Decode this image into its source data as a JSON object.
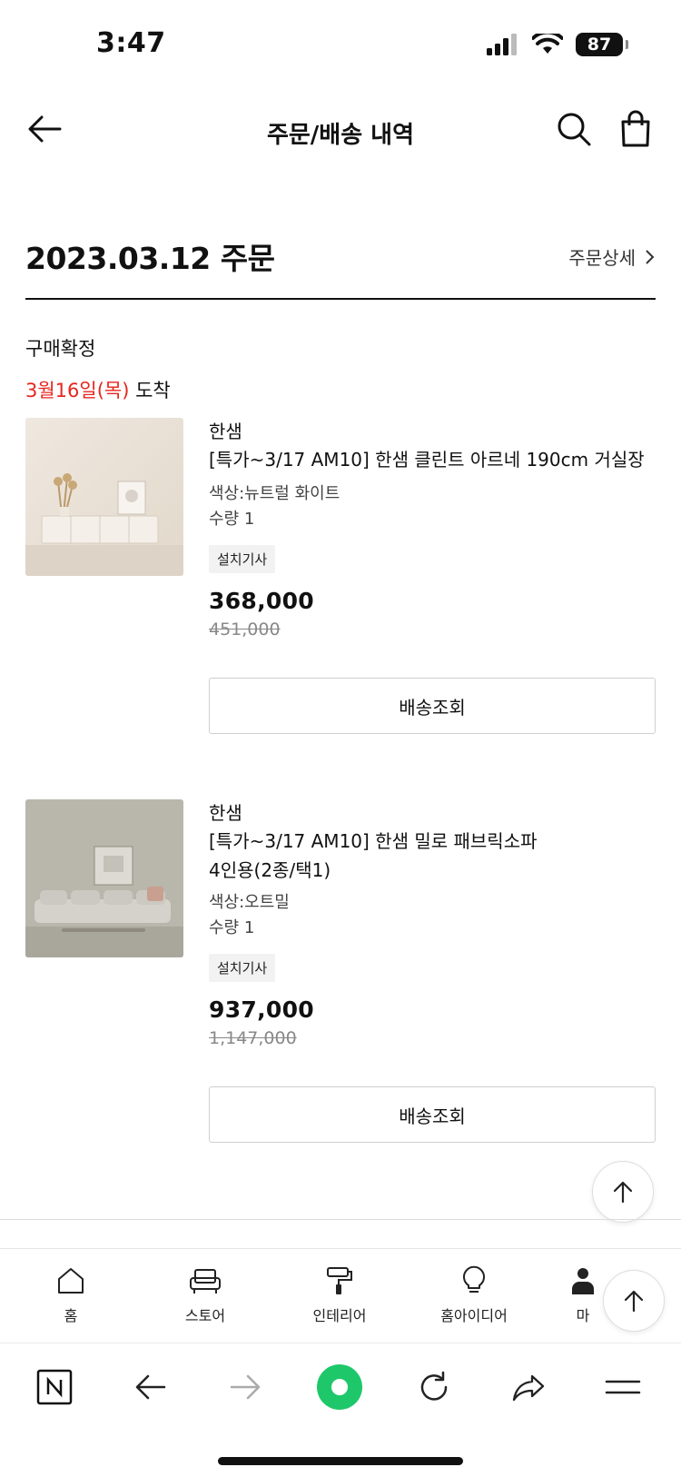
{
  "status_bar": {
    "time": "3:47",
    "battery": "87"
  },
  "nav": {
    "title": "주문/배송 내역"
  },
  "order": {
    "date_title": "2023.03.12 주문",
    "detail_link": "주문상세",
    "status": "구매확정",
    "arrival_date": "3월16일(목)",
    "arrival_suffix": " 도착"
  },
  "products": [
    {
      "brand": "한샘",
      "name_line1": "[특가~3/17 AM10] 한샘 클린트 아르네 190cm 거실장",
      "name_line2": "",
      "color": "색상:뉴트럴 화이트",
      "quantity": "수량 1",
      "tag": "설치기사",
      "price": "368,000",
      "original_price": "451,000",
      "button": "배송조회"
    },
    {
      "brand": "한샘",
      "name_line1": "[특가~3/17 AM10] 한샘 밀로 패브릭소파",
      "name_line2": "4인용(2종/택1)",
      "color": "색상:오트밀",
      "quantity": "수량 1",
      "tag": "설치기사",
      "price": "937,000",
      "original_price": "1,147,000",
      "button": "배송조회"
    }
  ],
  "tab_bar": {
    "items": [
      {
        "label": "홈",
        "icon": "home-icon"
      },
      {
        "label": "스토어",
        "icon": "sofa-icon"
      },
      {
        "label": "인테리어",
        "icon": "paint-roller-icon"
      },
      {
        "label": "홈아이디어",
        "icon": "lightbulb-icon"
      },
      {
        "label": "마",
        "icon": "person-icon"
      }
    ]
  },
  "browser_bar": {
    "items": [
      "naver-n-icon",
      "back-arrow-icon",
      "forward-arrow-icon",
      "green-dot-icon",
      "reload-icon",
      "share-icon",
      "menu-icon"
    ]
  },
  "colors": {
    "accent_red": "#e8251e",
    "green": "#1ec86a"
  }
}
